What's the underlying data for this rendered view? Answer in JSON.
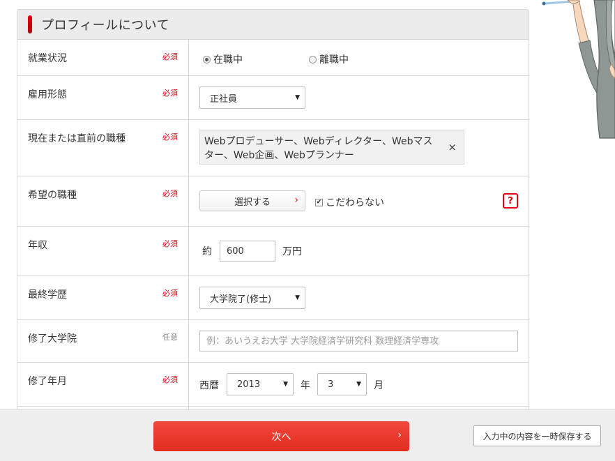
{
  "section": {
    "title": "プロフィールについて"
  },
  "badges": {
    "required": "必須",
    "optional": "任意"
  },
  "employment_status": {
    "label": "就業状況",
    "options": [
      {
        "label": "在職中",
        "selected": true
      },
      {
        "label": "離職中",
        "selected": false
      }
    ]
  },
  "employment_type": {
    "label": "雇用形態",
    "value": "正社員"
  },
  "current_job": {
    "label": "現在または直前の職種",
    "value": "Webプロデューサー、Webディレクター、Webマスター、Web企画、Webプランナー",
    "remove_icon": "×"
  },
  "desired_job": {
    "label": "希望の職種",
    "select_button": "選択する",
    "chevron": "›",
    "no_preference_label": "こだわらない",
    "no_preference_checked": true,
    "help": "?"
  },
  "income": {
    "label": "年収",
    "prefix": "約",
    "value": "600",
    "unit": "万円"
  },
  "education": {
    "label": "最終学歴",
    "value": "大学院了(修士)"
  },
  "graduate_school": {
    "label": "修了大学院",
    "value": "",
    "placeholder": "例：あいうえお大学 大学院経済学研究科 数理経済学専攻"
  },
  "graduation_date": {
    "label": "修了年月",
    "era": "西暦",
    "year": "2013",
    "year_unit": "年",
    "month": "3",
    "month_unit": "月"
  },
  "footer": {
    "next_label": "次へ",
    "next_chevron": "›",
    "save_label": "入力中の内容を一時保存する"
  },
  "colors": {
    "accent": "#e60012",
    "next_button": "#e8392d"
  }
}
